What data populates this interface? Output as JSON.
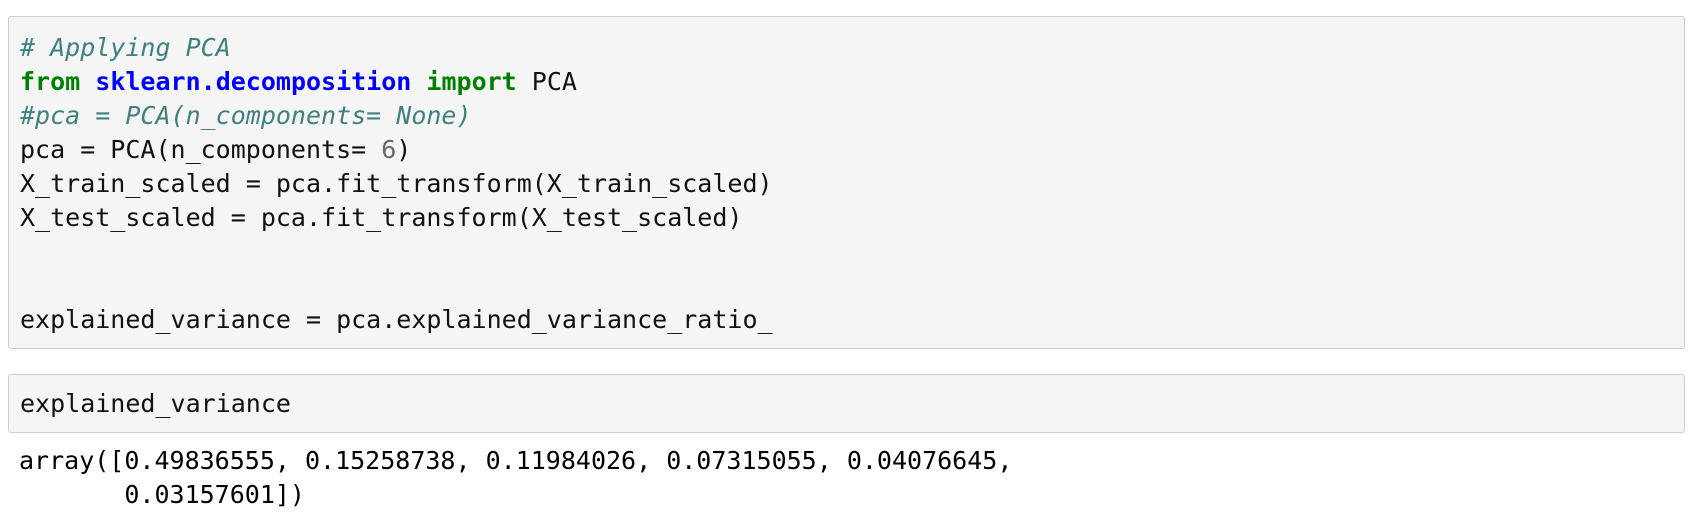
{
  "cell1": {
    "lines": [
      {
        "comment": "# Applying PCA"
      },
      {
        "kw_from": "from",
        "module": "sklearn.decomposition",
        "kw_import": "import",
        "name": "PCA"
      },
      {
        "comment": "#pca = PCA(n_components= None)"
      },
      {
        "pre": "pca = PCA(n_components= ",
        "num": "6",
        "post": ")"
      },
      {
        "text": "X_train_scaled = pca.fit_transform(X_train_scaled)"
      },
      {
        "text": "X_test_scaled = pca.fit_transform(X_test_scaled)"
      },
      {
        "text": ""
      },
      {
        "text": ""
      },
      {
        "text": "explained_variance = pca.explained_variance_ratio_"
      }
    ]
  },
  "cell2": {
    "code": "explained_variance"
  },
  "output": {
    "line1": "array([0.49836555, 0.15258738, 0.11984026, 0.07315055, 0.04076645,",
    "line2": "       0.03157601])"
  }
}
